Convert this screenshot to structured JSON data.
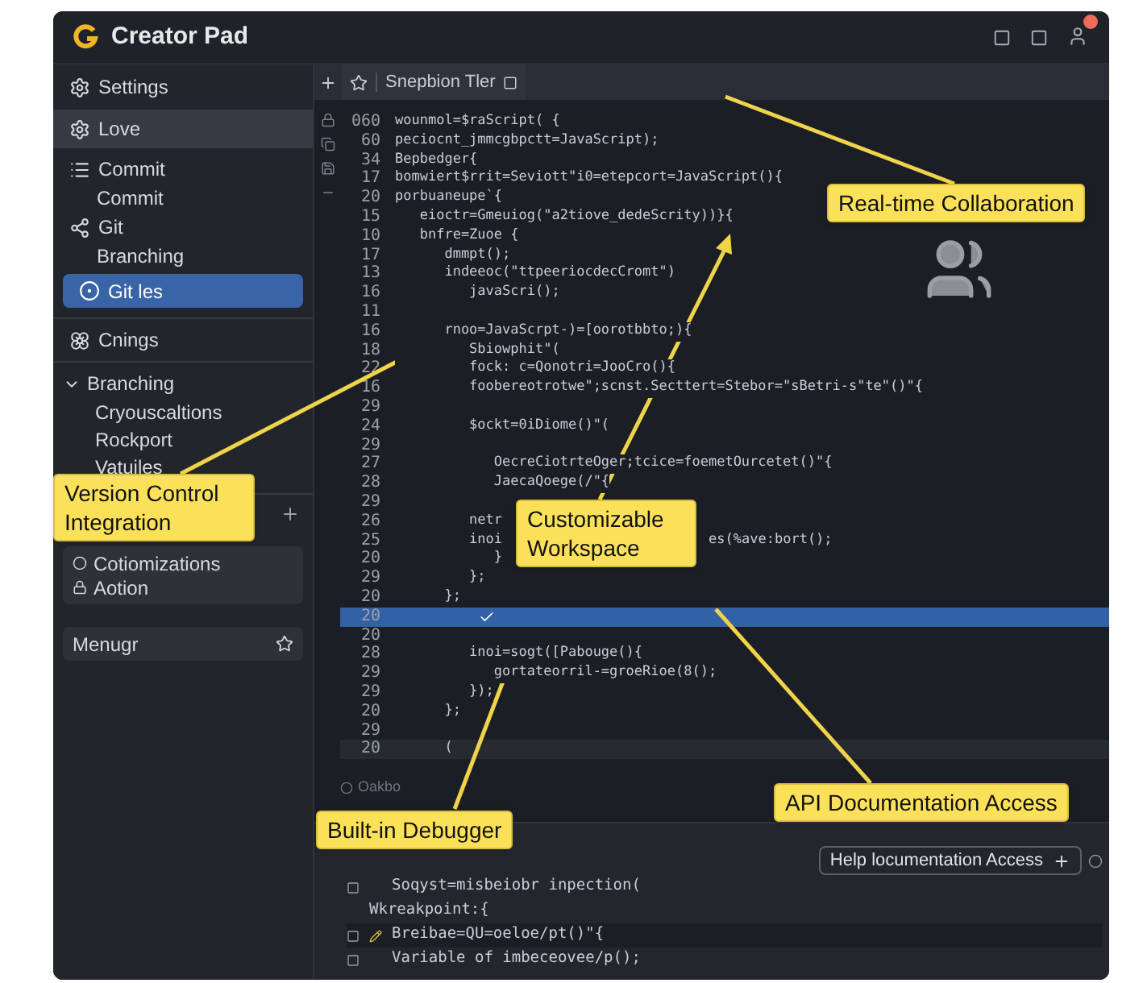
{
  "window": {
    "title": "Creator Pad",
    "notification": true
  },
  "sidebar": {
    "nav": [
      {
        "label": "Settings",
        "kind": "gear",
        "selected": false,
        "highlighted": false
      },
      {
        "label": "Love",
        "kind": "gear",
        "selected": false,
        "highlighted": true
      },
      {
        "label": "Commit",
        "kind": "list",
        "selected": false,
        "highlighted": false
      },
      {
        "label": "Commit",
        "kind": "plain",
        "selected": false,
        "highlighted": false
      },
      {
        "label": "Git",
        "kind": "nodes",
        "selected": false,
        "highlighted": false
      },
      {
        "label": "Branching",
        "kind": "plain",
        "selected": false,
        "highlighted": false
      },
      {
        "label": "Git les",
        "kind": "ring",
        "selected": true,
        "highlighted": false
      }
    ],
    "section": {
      "label": "Cnings"
    },
    "tree": {
      "label": "Branching",
      "expanded": true,
      "children": [
        {
          "label": "Cryouscaltions"
        },
        {
          "label": "Rockport"
        },
        {
          "label": "Vatuiles"
        }
      ]
    },
    "card": {
      "lines": [
        "Cotiomizations",
        "Aotion"
      ]
    },
    "footer_item": {
      "label": "Menugr"
    }
  },
  "editor": {
    "tab": {
      "label": "Snepbion Tler"
    },
    "lines": [
      {
        "n": "060",
        "text": "wounmol=$raScript( {",
        "kind": "normal"
      },
      {
        "n": "60",
        "text": "peciocnt_jmmcgbpctt=JavaScript);",
        "kind": "normal"
      },
      {
        "n": "34",
        "text": "Bepbedger{",
        "kind": "normal"
      },
      {
        "n": "17",
        "text": "bomwiert$rrit=Seviott\"i0=etepcort=JavaScript(){",
        "kind": "normal"
      },
      {
        "n": "20",
        "text": "porbuaneupe`{",
        "kind": "normal"
      },
      {
        "n": "15",
        "text": "   eioctr=Gmeuiog(\"a2tiove_dedeScrity))}{",
        "kind": "normal"
      },
      {
        "n": "10",
        "text": "   bnfre=Zuoe {",
        "kind": "normal"
      },
      {
        "n": "17",
        "text": "      dmmpt();",
        "kind": "normal"
      },
      {
        "n": "13",
        "text": "      indeeoc(\"ttpeeriocdecCromt\")",
        "kind": "normal"
      },
      {
        "n": "16",
        "text": "         javaScri();",
        "kind": "normal"
      },
      {
        "n": "11",
        "kind": "normal"
      },
      {
        "n": "16",
        "text": "      rnoo=JavaScrpt-)=[oorotbbto;){",
        "kind": "normal"
      },
      {
        "n": "18",
        "text": "         Sbiowphit\"(",
        "kind": "normal"
      },
      {
        "n": "22",
        "text": "         fock: c=Qonotri=JooCro(){",
        "kind": "normal"
      },
      {
        "n": "16",
        "text": "         foobereotrotwe\";scnst.Secttert=Stebor=\"sBetri-s\"te\"()\"{",
        "kind": "normal"
      },
      {
        "n": "29",
        "kind": "normal"
      },
      {
        "n": "24",
        "text": "         $ockt=0iDiome()\"(",
        "kind": "normal"
      },
      {
        "n": "29",
        "kind": "normal"
      },
      {
        "n": "27",
        "text": "            OecreCiotrteOger;tcice=foemetOurcetet()\"{",
        "kind": "normal"
      },
      {
        "n": "28",
        "text": "            JaecaQoege(/\"{",
        "kind": "normal"
      },
      {
        "n": "29",
        "kind": "normal"
      },
      {
        "n": "26",
        "text": "         netr",
        "kind": "normal"
      },
      {
        "n": "25",
        "text": "         inoi",
        "tail": "es(%ave:bort();",
        "kind": "normal"
      },
      {
        "n": "20",
        "text": "            }",
        "kind": "normal"
      },
      {
        "n": "29",
        "text": "         };",
        "kind": "normal"
      },
      {
        "n": "20",
        "text": "      };",
        "kind": "normal"
      },
      {
        "n": "20",
        "kind": "highlighted"
      },
      {
        "n": "20",
        "kind": "normal"
      },
      {
        "n": "28",
        "text": "         inoi=sogt([Pabouge(){",
        "kind": "normal"
      },
      {
        "n": "29",
        "text": "            gortateorril-=groeRioe(8();",
        "kind": "normal"
      },
      {
        "n": "29",
        "text": "         });",
        "kind": "normal"
      },
      {
        "n": "20",
        "text": "      };",
        "kind": "normal"
      },
      {
        "n": "29",
        "kind": "normal"
      },
      {
        "n": "20",
        "text": "      (",
        "kind": "current"
      }
    ]
  },
  "status_bar": {
    "label": "Oakbo"
  },
  "debug_panel": {
    "button": "Help locumentation Access",
    "lines": [
      {
        "text": "Soqyst=misbeiobr inpection(",
        "kind": "boxed"
      },
      {
        "text": "Wkreakpoint:{",
        "kind": "plain"
      },
      {
        "text": "Breibae=QU=oeloe/pt()\"{",
        "kind": "edit"
      },
      {
        "text": "Variable of imbeceovee/p();",
        "kind": "boxed"
      }
    ]
  },
  "callouts": [
    {
      "text": "Real-time Collaboration"
    },
    {
      "text": "Version Control Integration"
    },
    {
      "text": "Customizable Workspace"
    },
    {
      "text": "API Documentation Access"
    },
    {
      "text": "Built-in Debugger"
    }
  ]
}
